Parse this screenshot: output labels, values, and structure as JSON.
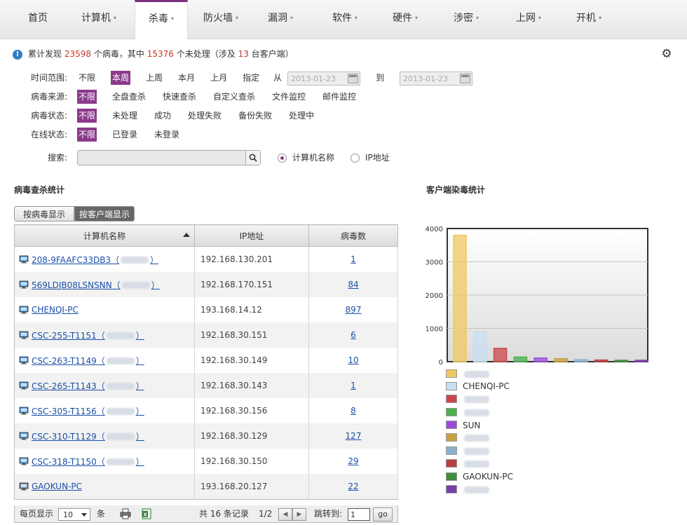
{
  "nav": {
    "tabs": [
      {
        "label": "首页",
        "caret": false,
        "active": false
      },
      {
        "label": "计算机",
        "caret": true,
        "active": false
      },
      {
        "label": "杀毒",
        "caret": true,
        "active": true
      },
      {
        "label": "防火墙",
        "caret": true,
        "active": false
      },
      {
        "label": "漏洞",
        "caret": true,
        "active": false
      },
      {
        "label": "软件",
        "caret": true,
        "active": false
      },
      {
        "label": "硬件",
        "caret": true,
        "active": false
      },
      {
        "label": "涉密",
        "caret": true,
        "active": false
      },
      {
        "label": "上网",
        "caret": true,
        "active": false
      },
      {
        "label": "开机",
        "caret": true,
        "active": false
      }
    ]
  },
  "summary": {
    "prefix": "累计发现",
    "virus_count": "23598",
    "mid1": "个病毒，其中",
    "unhandled": "15376",
    "mid2": "个未处理（涉及",
    "clients": "13",
    "suffix": "台客户端）"
  },
  "filters": {
    "time": {
      "label": "时间范围:",
      "options": [
        "不限",
        "本周",
        "上周",
        "本月",
        "上月",
        "指定"
      ],
      "selected": 1,
      "from_label": "从",
      "from_value": "2013-01-23",
      "to_label": "到",
      "to_value": "2013-01-23"
    },
    "source": {
      "label": "病毒来源:",
      "options": [
        "不限",
        "全盘查杀",
        "快速查杀",
        "自定义查杀",
        "文件监控",
        "邮件监控"
      ],
      "selected": 0
    },
    "status": {
      "label": "病毒状态:",
      "options": [
        "不限",
        "未处理",
        "成功",
        "处理失败",
        "备份失败",
        "处理中"
      ],
      "selected": 0
    },
    "online": {
      "label": "在线状态:",
      "options": [
        "不限",
        "已登录",
        "未登录"
      ],
      "selected": 0
    }
  },
  "search": {
    "label": "搜索:",
    "value": "",
    "radio_name": "计算机名称",
    "radio_ip": "IP地址",
    "selected": "name"
  },
  "stats": {
    "title": "病毒查杀统计",
    "toggle_virus": "按病毒显示",
    "toggle_client": "按客户端显示",
    "columns": [
      "计算机名称",
      "IP地址",
      "病毒数"
    ],
    "rows": [
      {
        "name": "208-9FAAFC33DB3（",
        "blur": true,
        "ip": "192.168.130.201",
        "count": "1",
        "online": true
      },
      {
        "name": "569LDJB08LSNSNN（",
        "blur": true,
        "ip": "192.168.170.151",
        "count": "84",
        "online": true
      },
      {
        "name": "CHENQI-PC",
        "blur": false,
        "ip": "193.168.14.12",
        "count": "897",
        "online": true
      },
      {
        "name": "CSC-255-T1151（",
        "blur": true,
        "ip": "192.168.30.151",
        "count": "6",
        "online": true
      },
      {
        "name": "CSC-263-T1149（",
        "blur": true,
        "ip": "192.168.30.149",
        "count": "10",
        "online": true
      },
      {
        "name": "CSC-265-T1143（",
        "blur": true,
        "ip": "192.168.30.143",
        "count": "1",
        "online": true
      },
      {
        "name": "CSC-305-T1156（",
        "blur": true,
        "ip": "192.168.30.156",
        "count": "8",
        "online": true
      },
      {
        "name": "CSC-310-T1129（",
        "blur": true,
        "ip": "192.168.30.129",
        "count": "127",
        "online": true
      },
      {
        "name": "CSC-318-T1150（",
        "blur": true,
        "ip": "192.168.30.150",
        "count": "29",
        "online": true
      },
      {
        "name": "GAOKUN-PC",
        "blur": false,
        "ip": "193.168.20.127",
        "count": "22",
        "online": false
      }
    ]
  },
  "pager": {
    "per_page_label": "每页显示",
    "per_page": "10",
    "unit": "条",
    "total_text": "共 16 条记录",
    "page": "1/2",
    "jump_label": "跳转到:",
    "jump_value": "1",
    "go": "go"
  },
  "chart_title": "客户端染毒统计",
  "chart_data": {
    "type": "bar",
    "title": "客户端染毒统计",
    "categories": [
      "(blurred)",
      "CHENQI-PC",
      "(blurred)",
      "(blurred)",
      "SUN",
      "(blurred)",
      "(blurred)",
      "(blurred)",
      "GAOKUN-PC",
      "(blurred)"
    ],
    "values": [
      3800,
      897,
      400,
      140,
      110,
      90,
      60,
      50,
      40,
      30
    ],
    "colors": [
      "#f0c860",
      "#c8dff2",
      "#c9474a",
      "#4caf50",
      "#9c4bd8",
      "#c9a040",
      "#8fb0cc",
      "#b84040",
      "#3e8f3e",
      "#7a3fa8"
    ],
    "yticks": [
      0,
      1000,
      2000,
      3000,
      4000
    ],
    "ylim": [
      0,
      4000
    ],
    "grid": true,
    "legend_position": "bottom",
    "legend": [
      {
        "label": "",
        "blur": true
      },
      {
        "label": "CHENQI-PC",
        "blur": false
      },
      {
        "label": "",
        "blur": true
      },
      {
        "label": "",
        "blur": true
      },
      {
        "label": "SUN",
        "blur": false
      },
      {
        "label": "",
        "blur": true
      },
      {
        "label": "",
        "blur": true
      },
      {
        "label": "",
        "blur": true
      },
      {
        "label": "GAOKUN-PC",
        "blur": false
      },
      {
        "label": "",
        "blur": true
      }
    ]
  }
}
